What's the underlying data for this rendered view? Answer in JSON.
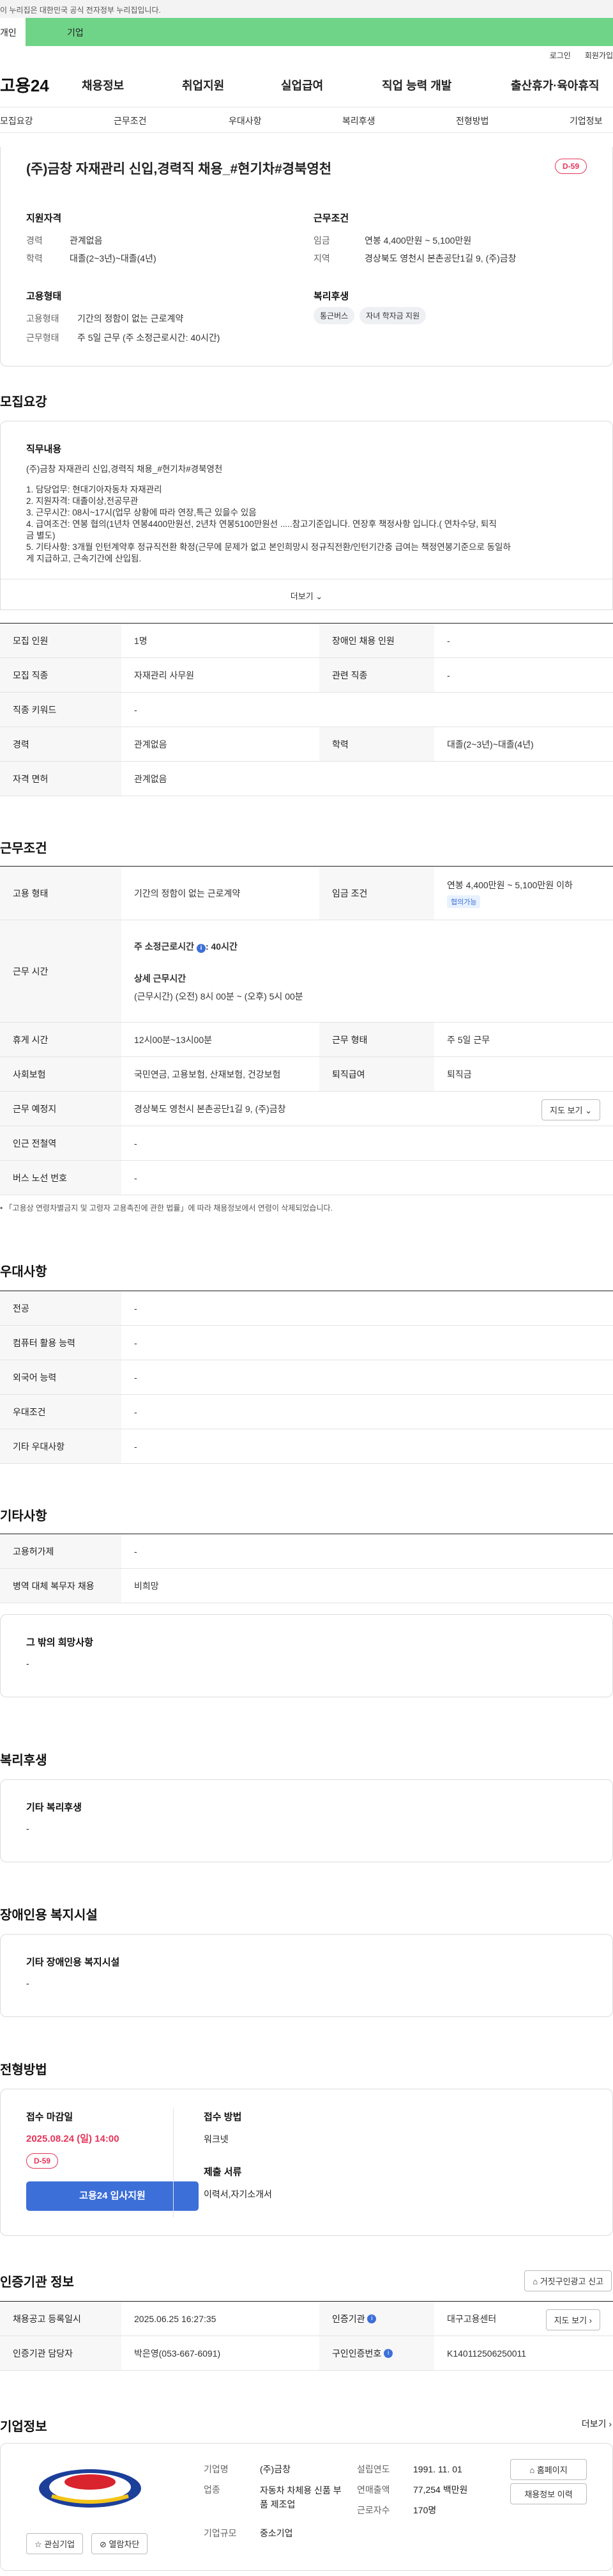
{
  "gov_bar": {
    "text": "이 누리집은 대한민국 공식 전자정부 누리집입니다."
  },
  "top_tabs": [
    {
      "label": "개인"
    },
    {
      "label": "기업"
    }
  ],
  "util_links": [
    {
      "label": "로그인"
    },
    {
      "label": "회원가입"
    }
  ],
  "brand": {
    "logo": "고용24",
    "accent": "#6fd487"
  },
  "gnb": [
    {
      "label": "채용정보"
    },
    {
      "label": "취업지원"
    },
    {
      "label": "실업급여"
    },
    {
      "label": "직업 능력 개발"
    },
    {
      "label": "출산휴가·육아휴직"
    }
  ],
  "snb": [
    {
      "label": "모집요강"
    },
    {
      "label": "근무조건"
    },
    {
      "label": "우대사항"
    },
    {
      "label": "복리후생"
    },
    {
      "label": "전형방법"
    },
    {
      "label": "기업정보"
    }
  ],
  "job": {
    "title": "(주)금창 자재관리 신입,경력직 채용_#현기차#경북영천",
    "dday": "D-59",
    "qual_heading": "지원자격",
    "qual": [
      {
        "k": "경력",
        "v": "관계없음"
      },
      {
        "k": "학력",
        "v": "대졸(2~3년)~대졸(4년)"
      }
    ],
    "cond_heading": "근무조건",
    "cond": [
      {
        "k": "임금",
        "v": "연봉 4,400만원 ~ 5,100만원"
      },
      {
        "k": "지역",
        "v": "경상북도 영천시 본촌공단1길 9, (주)금창"
      }
    ],
    "emp_heading": "고용형태",
    "emp": [
      {
        "k": "고용형태",
        "v": "기간의 정함이 없는 근로계약"
      },
      {
        "k": "근무형태",
        "v": "주 5일 근무 (주 소정근로시간: 40시간)"
      }
    ],
    "welfare_heading": "복리후생",
    "welfare_chips": [
      "통근버스",
      "자녀 학자금 지원"
    ]
  },
  "recruit": {
    "heading": "모집요강",
    "duty_heading": "직무내용",
    "duty_lines": [
      "(주)금창 자재관리 신입,경력직 채용_#현기차#경북영천",
      "1. 담당업무: 현대기아자동차 자재관리",
      "2. 지원자격: 대졸이상,전공무관",
      "3. 근무시간: 08시~17시(업무 상황에 따라 연장,특근 있을수 있음",
      "4. 급여조건: 연봉 협의(1년차 연봉4400만원선, 2년차 연봉5100만원선 .....참고기준입니다. 연장후 책정사항 입니다.( 연차수당, 퇴직",
      "금 별도)",
      "5. 기타사항: 3개월 인턴계약후 정규직전환 확정(근무에 문제가 없고 본인희망시 정규직전환/인턴기간중 급여는 책정연봉기준으로 동일하",
      "게 지급하고, 근속기간에 산입됨."
    ],
    "more": "더보기",
    "rows": [
      {
        "th": "모집 인원",
        "td": "1명",
        "th2": "장애인 채용 인원",
        "td2": "-"
      },
      {
        "th": "모집 직종",
        "td": "자재관리 사무원",
        "th2": "관련 직종",
        "td2": "-"
      },
      {
        "th": "직종 키워드",
        "td": "-"
      },
      {
        "th": "경력",
        "td": "관계없음",
        "th2": "학력",
        "td2": "대졸(2~3년)~대졸(4년)"
      },
      {
        "th": "자격 면허",
        "td": "관계없음"
      }
    ]
  },
  "work": {
    "heading": "근무조건",
    "emp_type_th": "고용 형태",
    "emp_type_td": "기간의 정함이 없는 근로계약",
    "wage_th": "임금 조건",
    "wage_td": "연봉 4,400만원 ~ 5,100만원 이하",
    "wage_badge": "협의가능",
    "hours_th": "근무 시간",
    "hours_main": "주 소정근로시간",
    "hours_main_value": ": 40시간",
    "hours_detail_h": "상세 근무시간",
    "hours_detail": "(근무시간) (오전) 8시 00분 ~ (오후) 5시 00분",
    "rows": [
      {
        "th": "휴게 시간",
        "td": "12시00분~13시00분",
        "th2": "근무 형태",
        "td2": "주 5일 근무"
      },
      {
        "th": "사회보험",
        "td": "국민연금, 고용보험, 산재보험, 건강보험",
        "th2": "퇴직급여",
        "td2": "퇴직금"
      }
    ],
    "place_th": "근무 예정지",
    "place_td": "경상북도 영천시 본촌공단1길 9, (주)금창",
    "map_btn": "지도 보기",
    "station_th": "인근 전철역",
    "station_td": "-",
    "bus_th": "버스 노선 번호",
    "bus_td": "-",
    "note": "「고용상 연령차별금지 및 고령자 고용촉진에 관한 법률」에 따라 채용정보에서 연령이 삭제되었습니다."
  },
  "pref": {
    "heading": "우대사항",
    "rows": [
      {
        "th": "전공",
        "td": "-"
      },
      {
        "th": "컴퓨터 활용 능력",
        "td": "-"
      },
      {
        "th": "외국어 능력",
        "td": "-"
      },
      {
        "th": "우대조건",
        "td": "-"
      },
      {
        "th": "기타 우대사항",
        "td": "-"
      }
    ]
  },
  "etc": {
    "heading": "기타사항",
    "rows": [
      {
        "th": "고용허가제",
        "td": "-"
      },
      {
        "th": "병역 대체 복무자 채용",
        "td": "비희망"
      }
    ],
    "box_h": "그 밖의 희망사항",
    "box_v": "-"
  },
  "benefit": {
    "heading": "복리후생",
    "box_h": "기타 복리후생",
    "box_v": "-"
  },
  "disabled": {
    "heading": "장애인용 복지시설",
    "box_h": "기타 장애인용 복지시설",
    "box_v": "-"
  },
  "process": {
    "heading": "전형방법",
    "deadline_h": "접수 마감일",
    "deadline": "2025.08.24 (일) 14:00",
    "dday": "D-59",
    "apply_btn": "고용24 입사지원",
    "method_h": "접수 방법",
    "method": "워크넷",
    "docs_h": "제출 서류",
    "docs": "이력서,자기소개서"
  },
  "auth": {
    "heading": "인증기관 정보",
    "report_btn": "거짓구인광고 신고",
    "rows": [
      {
        "th": "채용공고 등록일시",
        "td": "2025.06.25 16:27:35",
        "th2": "인증기관",
        "td2": "대구고용센터",
        "btn": "지도 보기"
      },
      {
        "th": "인증기관 담당자",
        "td": "박은영(053-667-6091)",
        "th2": "구인인증번호",
        "td2": "K140112506250011"
      }
    ]
  },
  "company": {
    "heading": "기업정보",
    "more": "더보기",
    "fav_btn": "관심기업",
    "block_btn": "열람차단",
    "fields": [
      {
        "k": "기업명",
        "v": "(주)금창"
      },
      {
        "k": "업종",
        "v": "자동차 차체용 신품 부품 제조업"
      },
      {
        "k": "기업규모",
        "v": "중소기업"
      }
    ],
    "fields2": [
      {
        "k": "설립연도",
        "v": "1991. 11. 01"
      },
      {
        "k": "연매출액",
        "v": "77,254 백만원"
      },
      {
        "k": "근로자수",
        "v": "170명"
      }
    ],
    "home_btn": "홈페이지",
    "jobs_btn": "채용정보 이력"
  }
}
